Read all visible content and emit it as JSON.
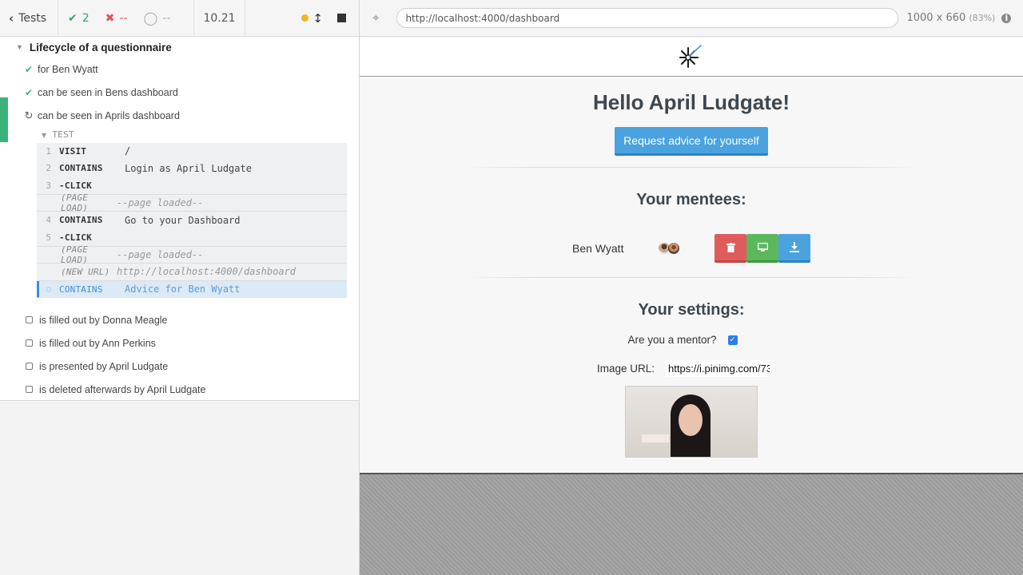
{
  "runner": {
    "tests_button": "Tests",
    "stats": {
      "passed": "2",
      "failed": "--",
      "pending": "--"
    },
    "duration": "10.21"
  },
  "suite": {
    "title": "Lifecycle of a questionnaire",
    "tests": [
      {
        "label": "for Ben Wyatt",
        "state": "passed"
      },
      {
        "label": "can be seen in Bens dashboard",
        "state": "passed"
      },
      {
        "label": "can be seen in Aprils dashboard",
        "state": "running"
      }
    ],
    "test_header": "TEST",
    "commands": [
      {
        "num": "1",
        "name": "VISIT",
        "msg": "/"
      },
      {
        "num": "2",
        "name": "CONTAINS",
        "msg": "Login as April Ludgate"
      },
      {
        "num": "3",
        "name": "-CLICK",
        "msg": ""
      },
      {
        "num": "",
        "name": "(PAGE LOAD)",
        "msg": "--page loaded--"
      },
      {
        "num": "4",
        "name": "CONTAINS",
        "msg": "Go to your Dashboard"
      },
      {
        "num": "5",
        "name": "-CLICK",
        "msg": ""
      },
      {
        "num": "",
        "name": "(PAGE LOAD)",
        "msg": "--page loaded--"
      },
      {
        "num": "",
        "name": "(NEW URL)",
        "msg": "http://localhost:4000/dashboard"
      },
      {
        "num": "",
        "name": "CONTAINS",
        "msg": "Advice for Ben Wyatt"
      }
    ],
    "pending": [
      "is filled out by Donna Meagle",
      "is filled out by Ann Perkins",
      "is presented by April Ludgate",
      "is deleted afterwards by April Ludgate"
    ]
  },
  "aut": {
    "url": "http://localhost:4000/dashboard",
    "viewport": "1000 x 660",
    "zoom": "(83%)"
  },
  "page": {
    "greeting": "Hello April Ludgate!",
    "request_button": "Request advice for yourself",
    "mentees_title": "Your mentees:",
    "mentee_name": "Ben Wyatt",
    "settings_title": "Your settings:",
    "mentor_label": "Are you a mentor?",
    "mentor_checked": true,
    "image_url_label": "Image URL:",
    "image_url_value": "https://i.pinimg.com/73"
  },
  "colors": {
    "pass": "#3bb27a",
    "fail": "#e94f4f",
    "active_command": "#3b8fd8",
    "primary_button": "#4aa3df",
    "delete_button": "#e05c5c",
    "view_button": "#5cb85c"
  }
}
